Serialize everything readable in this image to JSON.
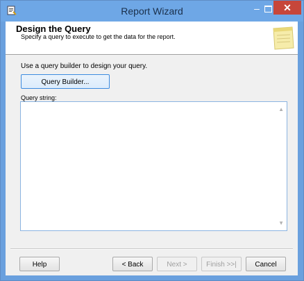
{
  "window": {
    "title": "Report Wizard"
  },
  "header": {
    "title": "Design the Query",
    "subtitle": "Specify a query to execute to get the data for the report."
  },
  "body": {
    "instruction": "Use a query builder to design your query.",
    "query_builder_label": "Query Builder...",
    "query_string_label": "Query string:",
    "query_string_value": ""
  },
  "footer": {
    "help_label": "Help",
    "back_label": "< Back",
    "next_label": "Next >",
    "finish_label": "Finish >>|",
    "cancel_label": "Cancel"
  },
  "colors": {
    "titlebar": "#6ea7e6",
    "close_button": "#c7463a",
    "header_bg": "#ffffff",
    "body_bg": "#f0f0f0"
  },
  "icons": {
    "app": "report-wizard-icon",
    "header": "notepad-icon"
  }
}
